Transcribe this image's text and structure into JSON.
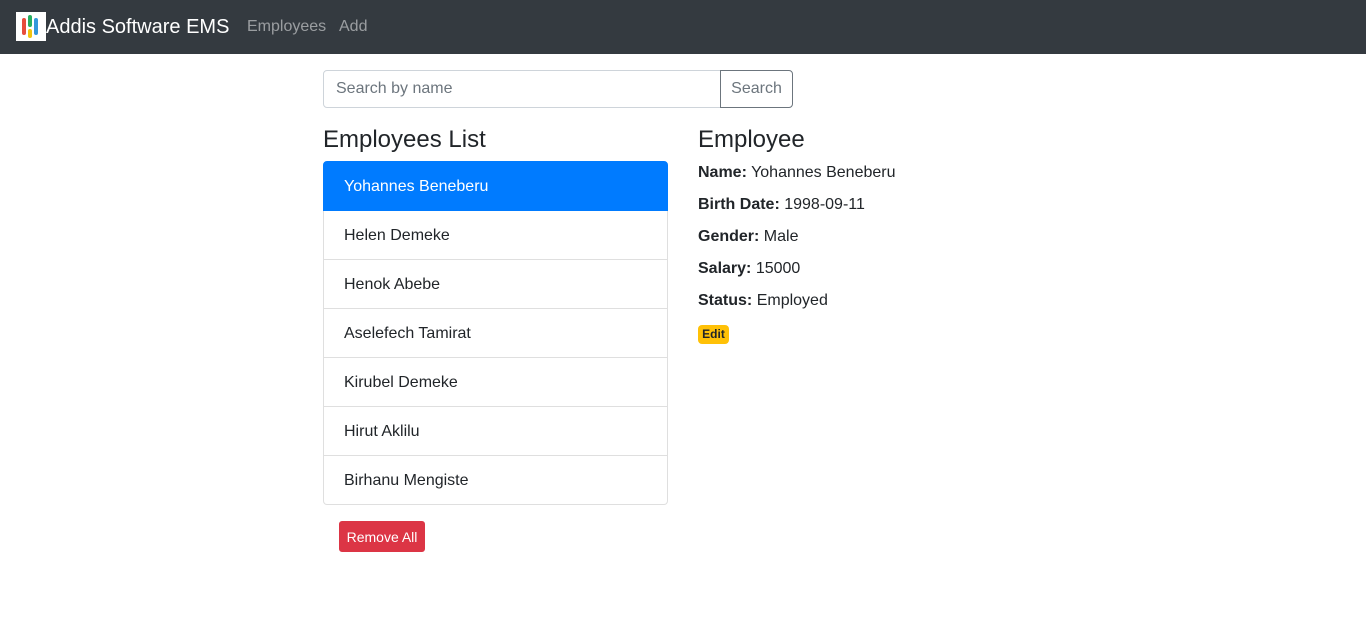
{
  "navbar": {
    "brand": "Addis Software EMS",
    "links": [
      {
        "label": "Employees"
      },
      {
        "label": "Add"
      }
    ],
    "logo_colors": [
      "#e74c3c",
      "#27ae60",
      "#3498db",
      "#f1c40f"
    ]
  },
  "search": {
    "placeholder": "Search by name",
    "value": "",
    "button_label": "Search"
  },
  "list": {
    "title": "Employees List",
    "items": [
      {
        "name": "Yohannes Beneberu",
        "active": true
      },
      {
        "name": "Helen Demeke",
        "active": false
      },
      {
        "name": "Henok Abebe",
        "active": false
      },
      {
        "name": "Aselefech Tamirat",
        "active": false
      },
      {
        "name": "Kirubel Demeke",
        "active": false
      },
      {
        "name": "Hirut Aklilu",
        "active": false
      },
      {
        "name": "Birhanu Mengiste",
        "active": false
      }
    ],
    "remove_all_label": "Remove All"
  },
  "detail": {
    "title": "Employee",
    "fields": [
      {
        "label": "Name:",
        "value": "Yohannes Beneberu"
      },
      {
        "label": "Birth Date:",
        "value": "1998-09-11"
      },
      {
        "label": "Gender:",
        "value": "Male"
      },
      {
        "label": "Salary:",
        "value": "15000"
      },
      {
        "label": "Status:",
        "value": "Employed"
      }
    ],
    "edit_label": "Edit"
  },
  "colors": {
    "navbar_bg": "#343a40",
    "active_item": "#007bff",
    "danger": "#dc3545",
    "warning": "#ffc107"
  }
}
